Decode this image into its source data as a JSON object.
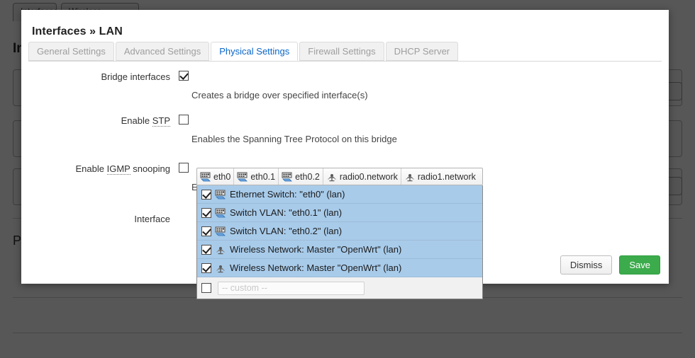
{
  "background": {
    "tabs": [
      "Interfaces",
      "Wireless"
    ],
    "heading": "Interfaces",
    "section_text": "Port"
  },
  "modal": {
    "title": "Interfaces » LAN",
    "tabs": [
      {
        "label": "General Settings",
        "active": false
      },
      {
        "label": "Advanced Settings",
        "active": false
      },
      {
        "label": "Physical Settings",
        "active": true
      },
      {
        "label": "Firewall Settings",
        "active": false
      },
      {
        "label": "DHCP Server",
        "active": false
      }
    ],
    "fields": [
      {
        "label": "Bridge interfaces",
        "abbr": "",
        "checked": true,
        "hint": "Creates a bridge over specified interface(s)"
      },
      {
        "label_before": "Enable ",
        "abbr": "STP",
        "label_after": "",
        "checked": false,
        "hint": "Enables the Spanning Tree Protocol on this bridge"
      },
      {
        "label_before": "Enable ",
        "abbr": "IGMP",
        "label_after": " snooping",
        "checked": false,
        "hint": "Enables IGMP snooping on this bridge"
      }
    ],
    "interface": {
      "label": "Interface",
      "selected_chips": [
        {
          "text": "eth0",
          "icon": "ethernet-icon"
        },
        {
          "text": "eth0.1",
          "icon": "ethernet-icon"
        },
        {
          "text": "eth0.2",
          "icon": "ethernet-icon"
        },
        {
          "text": "radio0.network",
          "icon": "wireless-icon"
        },
        {
          "text": "radio1.network",
          "icon": "wireless-icon"
        }
      ],
      "dropdown_arrow": "▼",
      "options": [
        {
          "text": "Ethernet Switch: \"eth0\" (lan)",
          "icon": "ethernet-icon",
          "checked": true
        },
        {
          "text": "Switch VLAN: \"eth0.1\" (lan)",
          "icon": "ethernet-icon",
          "checked": true
        },
        {
          "text": "Switch VLAN: \"eth0.2\" (lan)",
          "icon": "ethernet-icon",
          "checked": true
        },
        {
          "text": "Wireless Network: Master \"OpenWrt\" (lan)",
          "icon": "wireless-icon",
          "checked": true
        },
        {
          "text": "Wireless Network: Master \"OpenWrt\" (lan)",
          "icon": "wireless-icon",
          "checked": true
        }
      ],
      "custom": {
        "checked": false,
        "placeholder": "-- custom --"
      }
    },
    "footer": {
      "dismiss_label": "Dismiss",
      "save_label": "Save"
    }
  },
  "colors": {
    "accent_tab": "#0a66c9",
    "save_button": "#3cab4c",
    "option_selected": "#a8cbea",
    "overlay": "rgba(0,0,0,0.66)"
  }
}
